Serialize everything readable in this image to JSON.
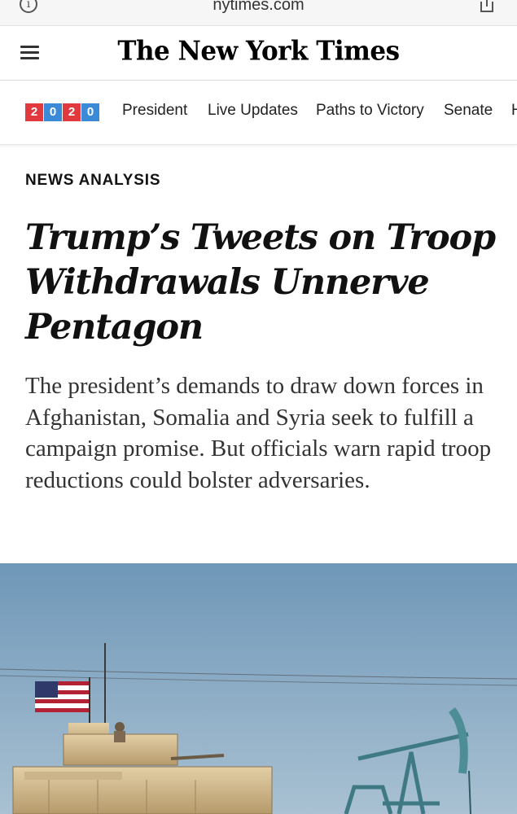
{
  "browser": {
    "url": "nytimes.com",
    "info_icon": "i"
  },
  "masthead": {
    "logo": "The New York Times"
  },
  "election_nav": {
    "badge_digits": [
      "2",
      "0",
      "2",
      "0"
    ],
    "items": [
      "President",
      "Live Updates",
      "Paths to Victory",
      "Senate",
      "H"
    ]
  },
  "article": {
    "kicker": "NEWS ANALYSIS",
    "headline": "Trump’s Tweets on Troop Withdrawals Unnerve Pentagon",
    "summary": "The president’s demands to draw down forces in Afghanistan, Somalia and Syria seek to fulfill a campaign promise. But officials warn rapid troop reductions could bolster adversaries."
  },
  "colors": {
    "badge_red": "#e03a3e",
    "badge_blue": "#3a8ad8",
    "sky": "#7ea3bf"
  }
}
